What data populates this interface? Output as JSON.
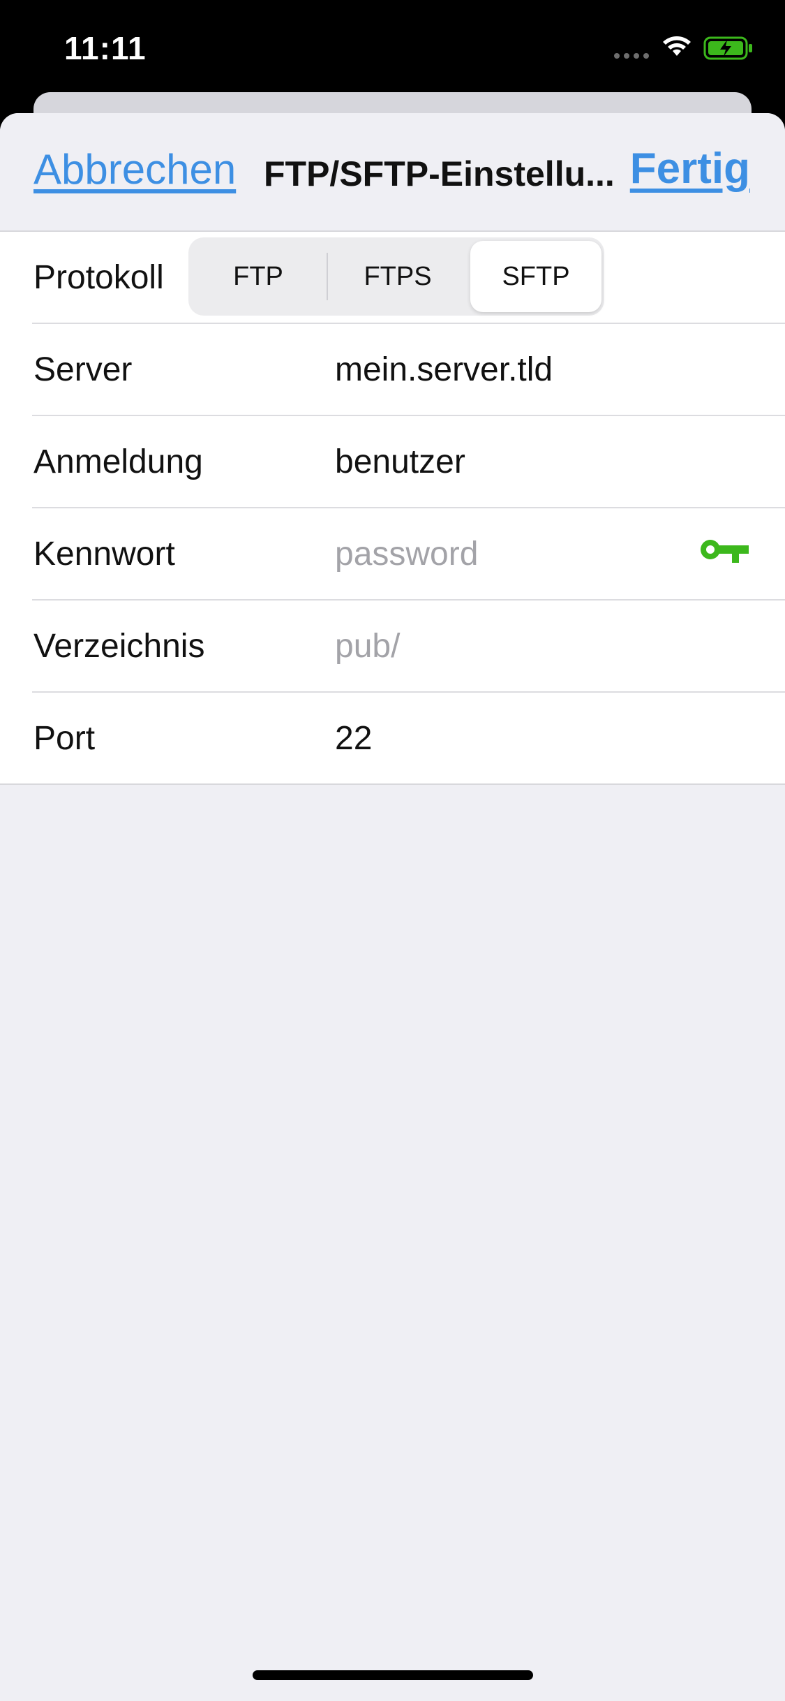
{
  "status_bar": {
    "time": "11:11"
  },
  "nav": {
    "cancel_label": "Abbrechen",
    "title": "FTP/SFTP-Einstellu...",
    "done_label": "Fertig"
  },
  "protocol": {
    "label": "Protokoll",
    "options": [
      "FTP",
      "FTPS",
      "SFTP"
    ],
    "selected": "SFTP"
  },
  "fields": {
    "server": {
      "label": "Server",
      "value": "mein.server.tld"
    },
    "login": {
      "label": "Anmeldung",
      "value": "benutzer"
    },
    "password": {
      "label": "Kennwort",
      "placeholder": "password"
    },
    "directory": {
      "label": "Verzeichnis",
      "placeholder": "pub/"
    },
    "port": {
      "label": "Port",
      "value": "22"
    }
  },
  "colors": {
    "accent": "#3d8fe3",
    "key": "#3cb81c"
  },
  "icons": [
    "wifi-icon",
    "battery-charging-icon",
    "key-icon"
  ]
}
